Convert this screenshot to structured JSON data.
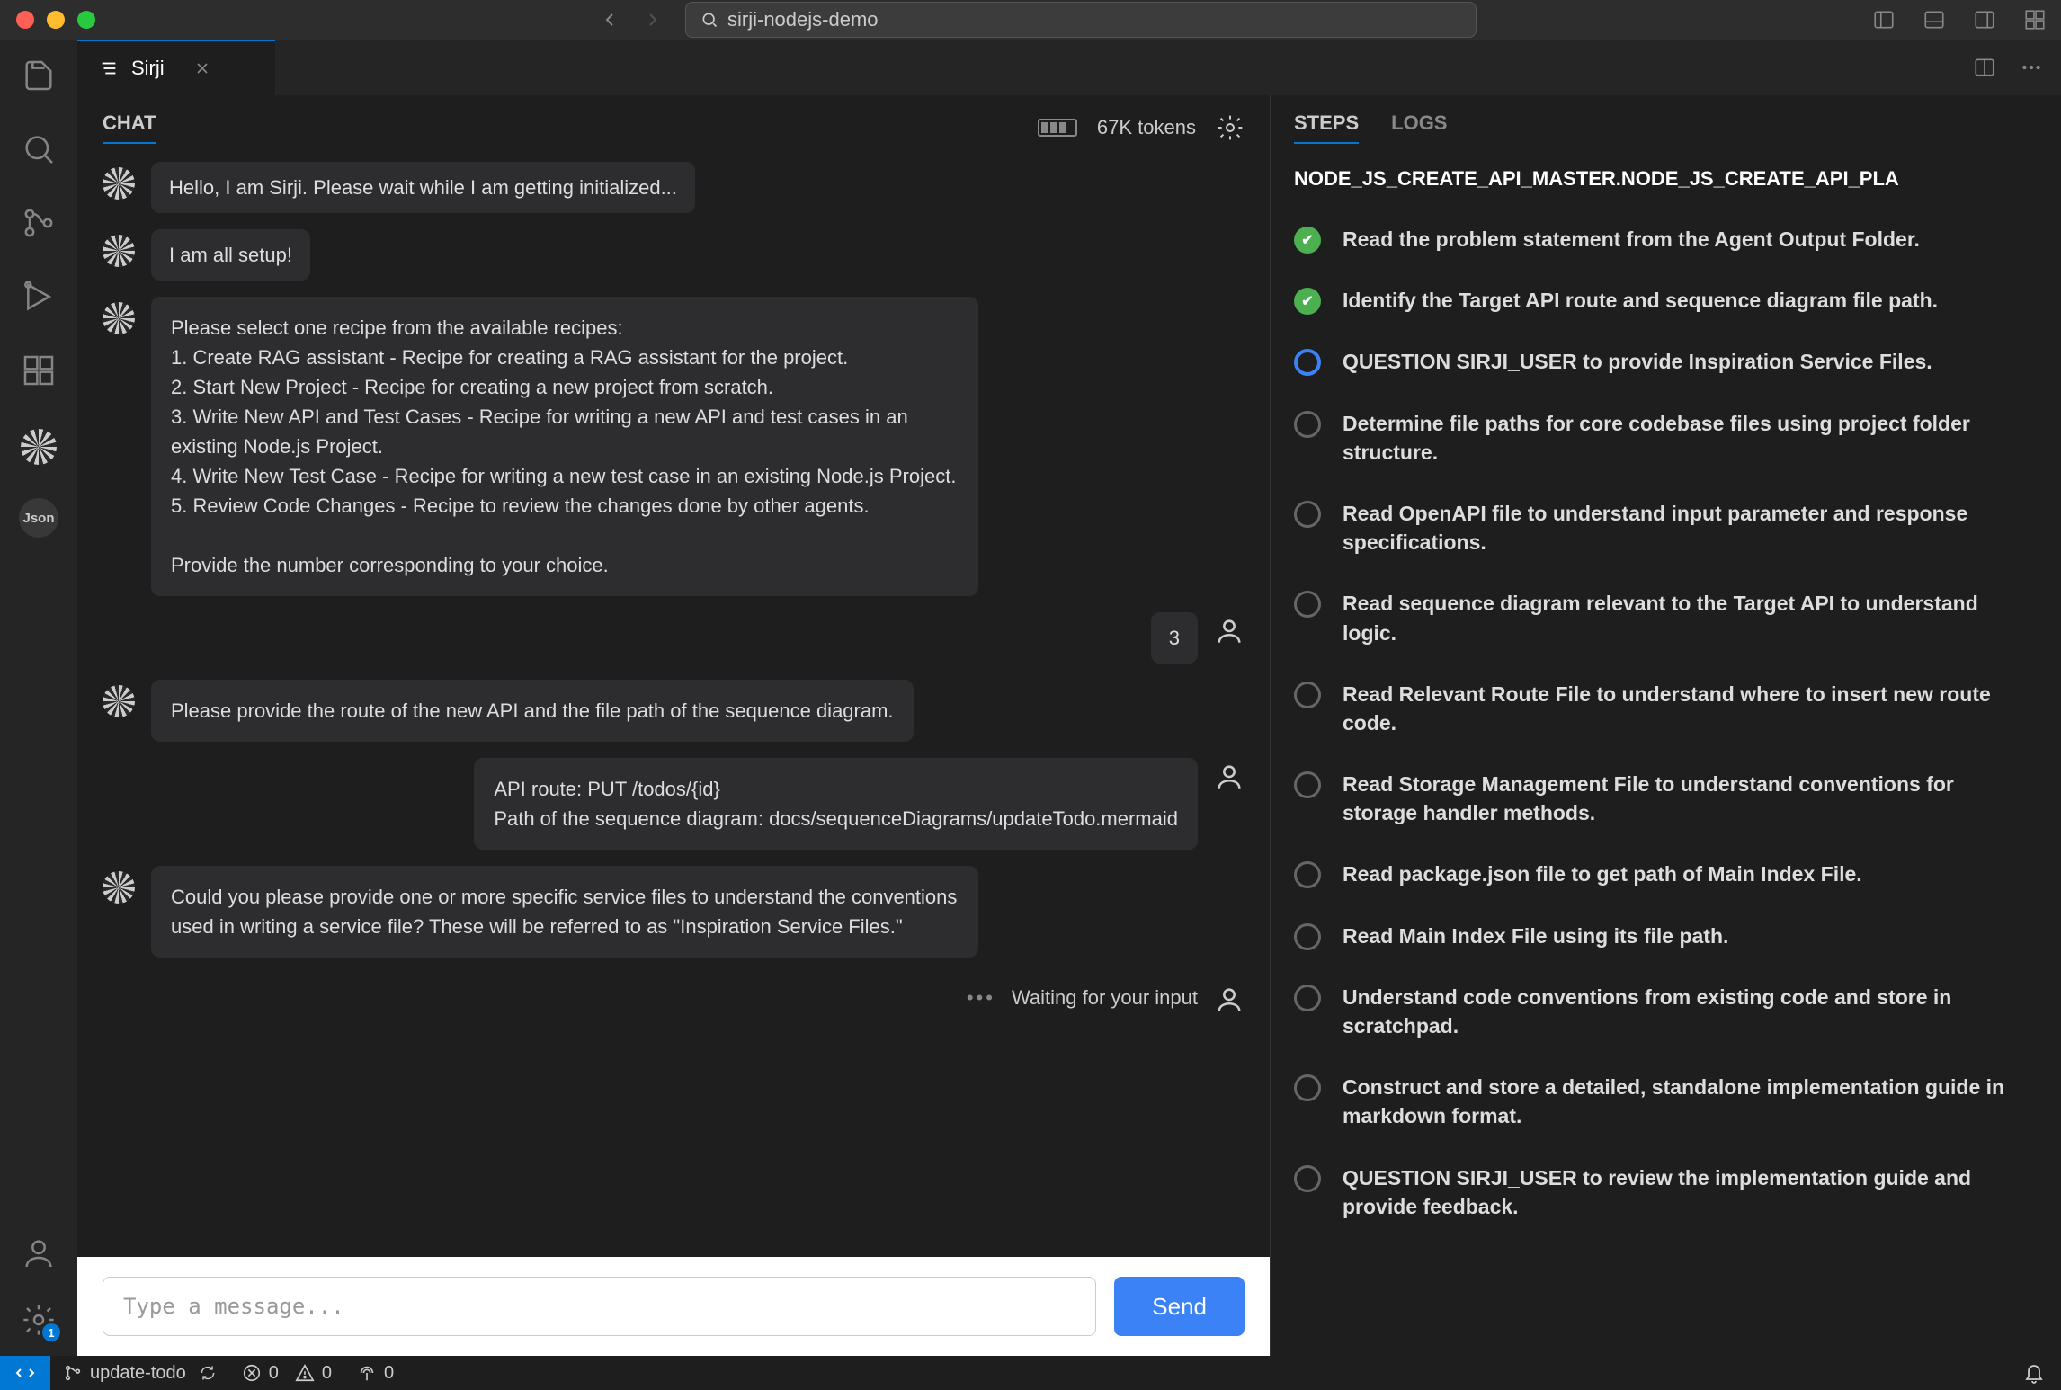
{
  "titlebar": {
    "search_text": "sirji-nodejs-demo"
  },
  "tab": {
    "title": "Sirji"
  },
  "chat": {
    "tab_label": "CHAT",
    "tokens_label": "67K tokens",
    "messages": {
      "m1": "Hello, I am Sirji. Please wait while I am getting initialized...",
      "m2": "I am all setup!",
      "m3": "Please select one recipe from the available recipes:\n1. Create RAG assistant - Recipe for creating a RAG assistant for the project.\n2. Start New Project - Recipe for creating a new project from scratch.\n3. Write New API and Test Cases - Recipe for writing a new API and test cases in an existing Node.js Project.\n4. Write New Test Case - Recipe for writing a new test case in an existing Node.js Project.\n5. Review Code Changes - Recipe to review the changes done by other agents.\n\nProvide the number corresponding to your choice.",
      "u1": "3",
      "m4": "Please provide the route of the new API and the file path of the sequence diagram.",
      "u2": "API route: PUT /todos/{id}\nPath of the sequence diagram: docs/sequenceDiagrams/updateTodo.mermaid",
      "m5": "Could you please provide one or more specific service files to understand the conventions used in writing a service file? These will be referred to as \"Inspiration Service Files.\""
    },
    "waiting_text": "Waiting for your input",
    "input_placeholder": "Type a message...",
    "send_label": "Send"
  },
  "steps": {
    "tab_steps": "STEPS",
    "tab_logs": "LOGS",
    "breadcrumb": "NODE_JS_CREATE_API_MASTER.NODE_JS_CREATE_API_PLA",
    "items": [
      {
        "status": "done",
        "text": "Read the problem statement from the Agent Output Folder."
      },
      {
        "status": "done",
        "text": "Identify the Target API route and sequence diagram file path."
      },
      {
        "status": "current",
        "text": "QUESTION SIRJI_USER to provide Inspiration Service Files."
      },
      {
        "status": "pending",
        "text": "Determine file paths for core codebase files using project folder structure."
      },
      {
        "status": "pending",
        "text": "Read OpenAPI file to understand input parameter and response specifications."
      },
      {
        "status": "pending",
        "text": "Read sequence diagram relevant to the Target API to understand logic."
      },
      {
        "status": "pending",
        "text": "Read Relevant Route File to understand where to insert new route code."
      },
      {
        "status": "pending",
        "text": "Read Storage Management File to understand conventions for storage handler methods."
      },
      {
        "status": "pending",
        "text": "Read package.json file to get path of Main Index File."
      },
      {
        "status": "pending",
        "text": "Read Main Index File using its file path."
      },
      {
        "status": "pending",
        "text": "Understand code conventions from existing code and store in scratchpad."
      },
      {
        "status": "pending",
        "text": "Construct and store a detailed, standalone implementation guide in markdown format."
      },
      {
        "status": "pending",
        "text": "QUESTION SIRJI_USER to review the implementation guide and provide feedback."
      }
    ]
  },
  "statusbar": {
    "branch": "update-todo",
    "errors": "0",
    "warnings": "0",
    "ports": "0",
    "settings_badge": "1"
  },
  "json_icon_label": "Json"
}
